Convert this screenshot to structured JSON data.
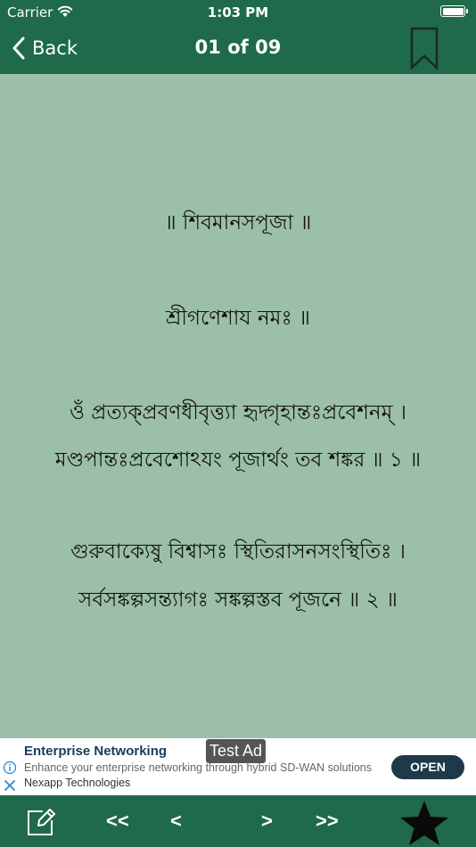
{
  "status_bar": {
    "carrier": "Carrier",
    "time": "1:03 PM"
  },
  "nav_bar": {
    "back_label": "Back",
    "title": "01 of 09"
  },
  "content": {
    "lines": [
      "॥ শিবমানসপূজা ॥",
      "শ্রীগণেশায নমঃ ॥",
      "ওঁ প্রত্যক্প্রবণধীবৃত্ত্যা হৃদ্গৃহান্তঃপ্রবেশনম্ ।",
      "মণ্ডপান্তঃপ্রবেশোঽযং পূজার্থং তব শঙ্কর ॥ ১ ॥",
      "গুরুবাক্যেষু বিশ্বাসঃ স্থিতিরাসনসংস্থিতিঃ ।",
      "সর্বসঙ্কল্পসন্ত্যাগঃ সঙ্কল্পস্তব পূজনে ॥ ২ ॥"
    ]
  },
  "ad": {
    "badge": "Test Ad",
    "title": "Enterprise Networking",
    "description": "Enhance your enterprise networking through hybrid SD-WAN solutions",
    "advertiser": "Nexapp Technologies",
    "cta": "OPEN"
  },
  "toolbar": {
    "first_label": "<<",
    "prev_label": "<",
    "next_label": ">",
    "last_label": ">>"
  },
  "colors": {
    "bar": "#1e6a4a",
    "content_bg": "#9bbfa8",
    "ad_button": "#1e3a4a"
  }
}
